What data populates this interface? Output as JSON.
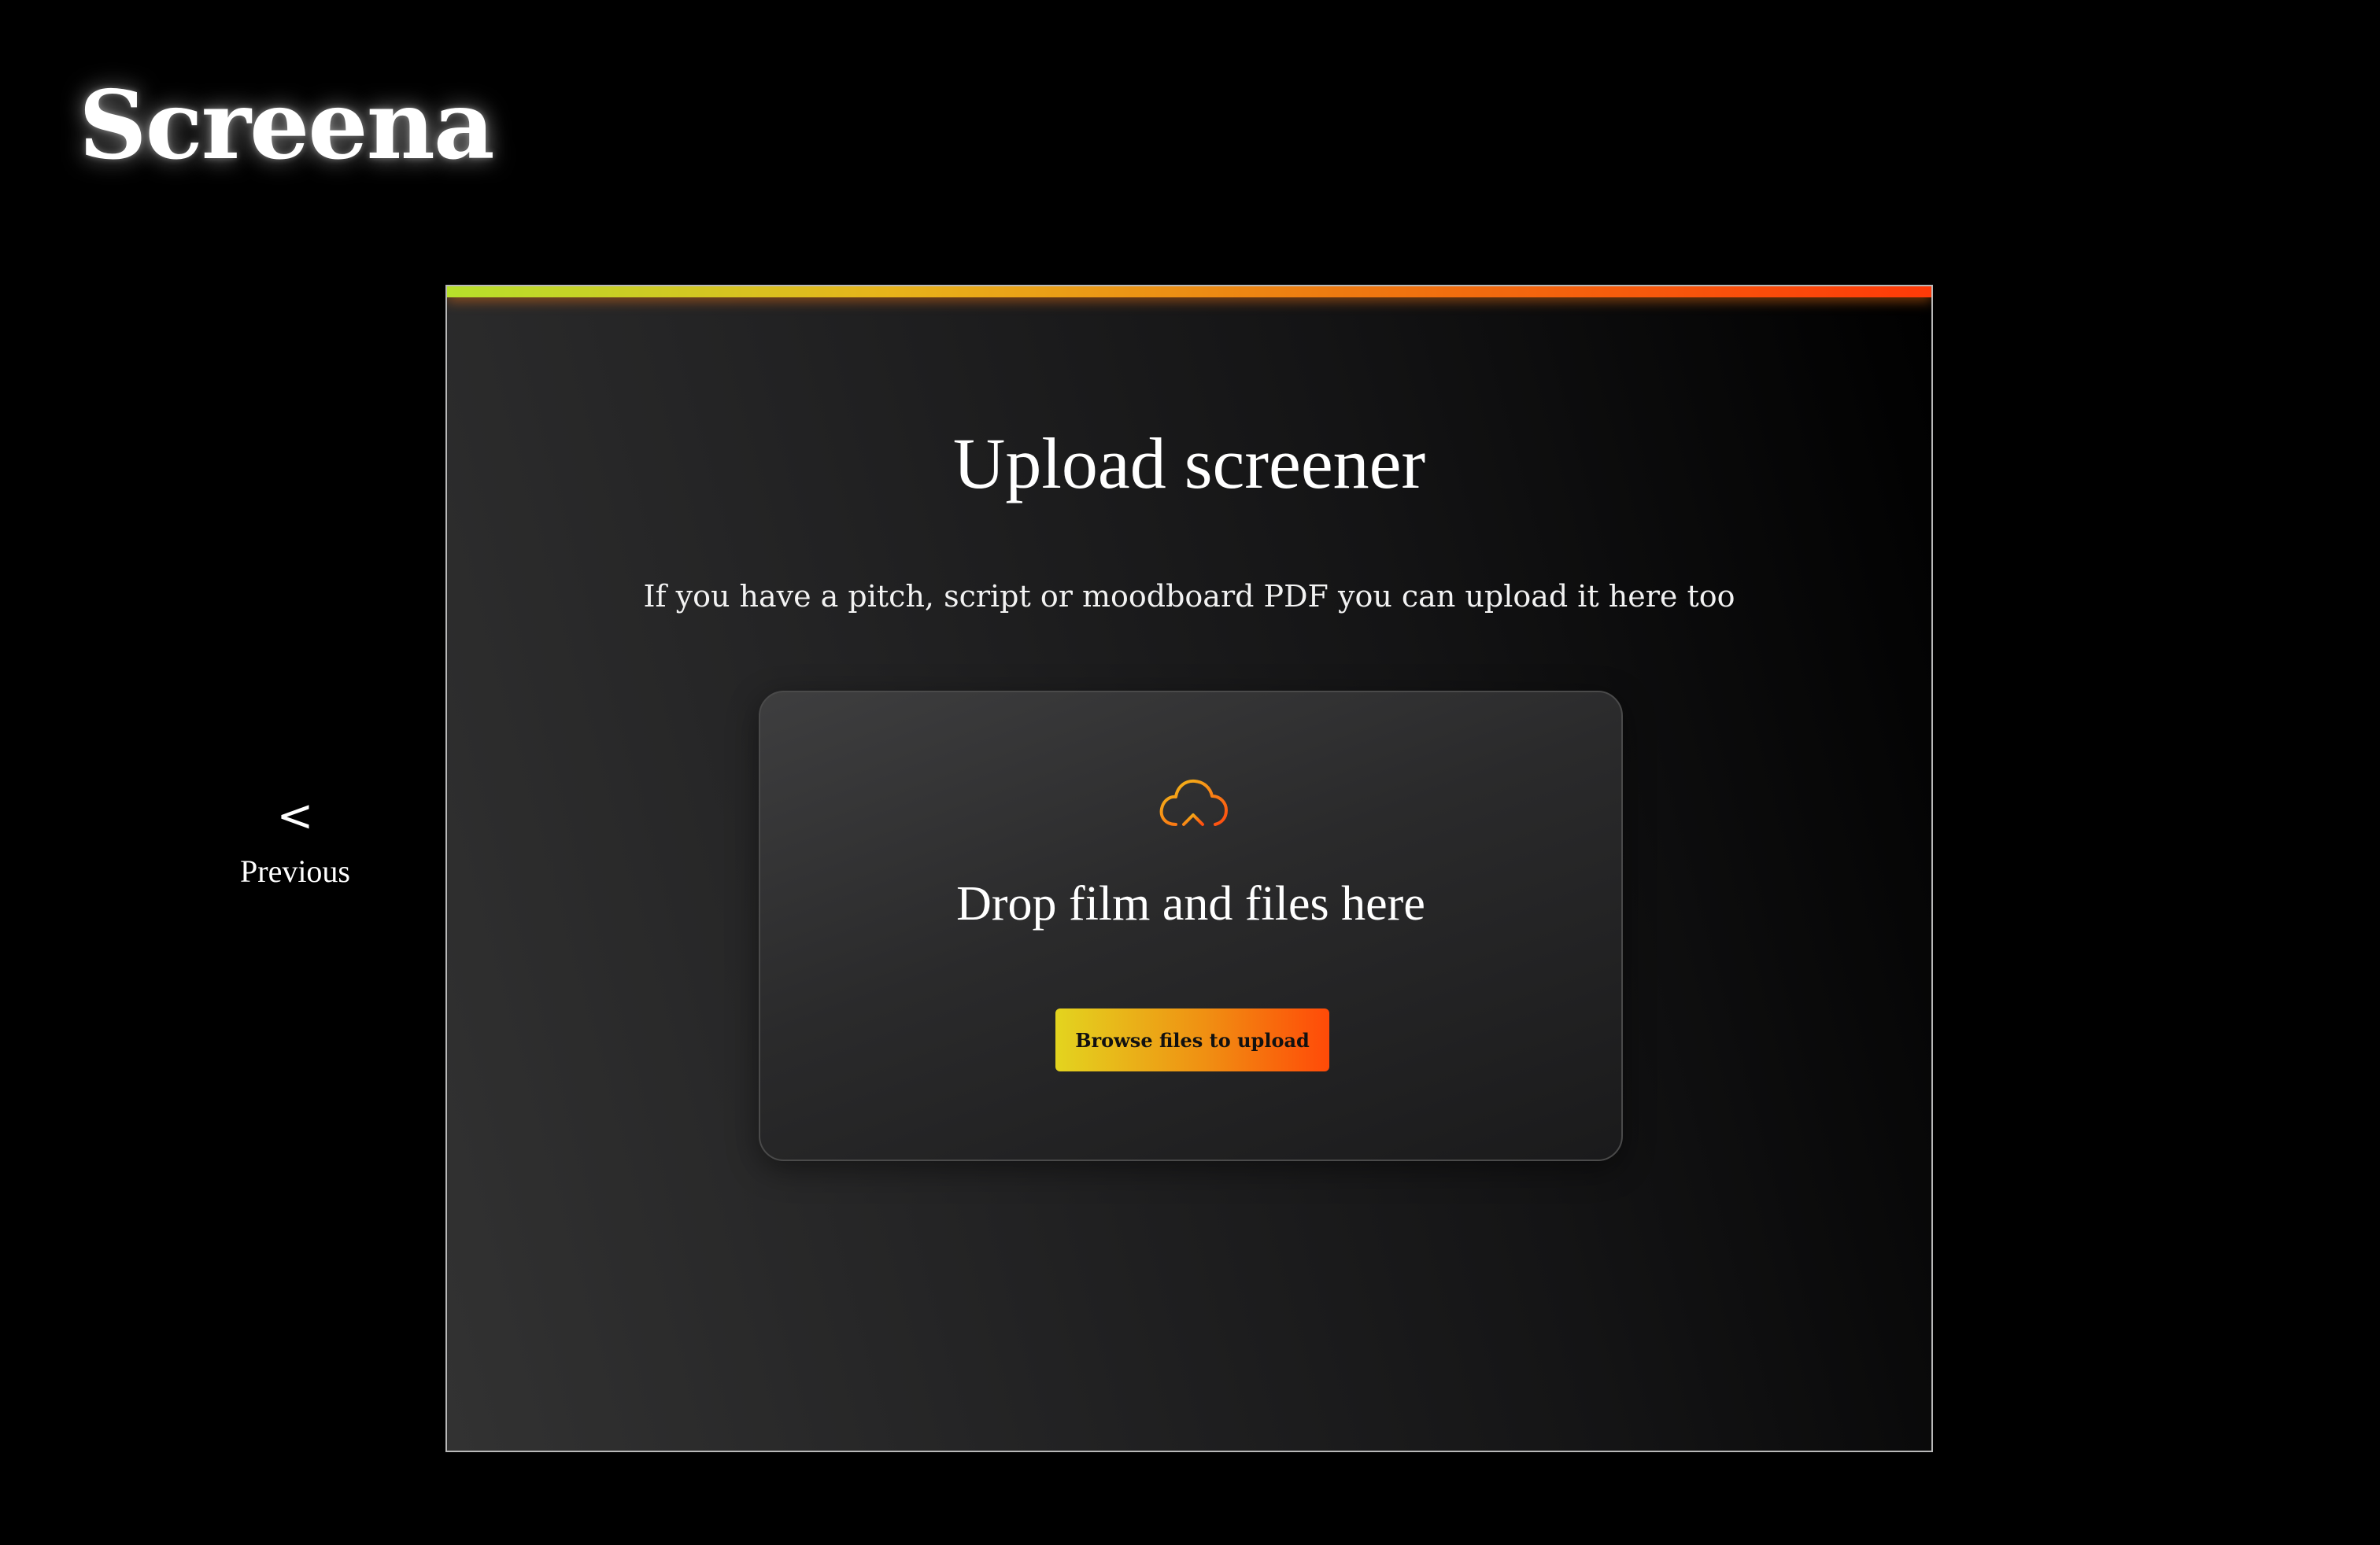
{
  "brand": {
    "logo_text": "Screena"
  },
  "nav": {
    "previous_icon": "<",
    "previous_label": "Previous"
  },
  "upload": {
    "title": "Upload screener",
    "subtitle": "If you have a pitch, script or moodboard PDF you can upload it here too",
    "dropzone_text": "Drop film and files here",
    "browse_button_label": "Browse files to upload",
    "icon": "cloud-upload-icon"
  },
  "colors": {
    "background": "#000000",
    "gradient_start": "#b7e02b",
    "gradient_mid": "#f08f12",
    "gradient_end": "#ff3a08",
    "text": "#ffffff"
  }
}
